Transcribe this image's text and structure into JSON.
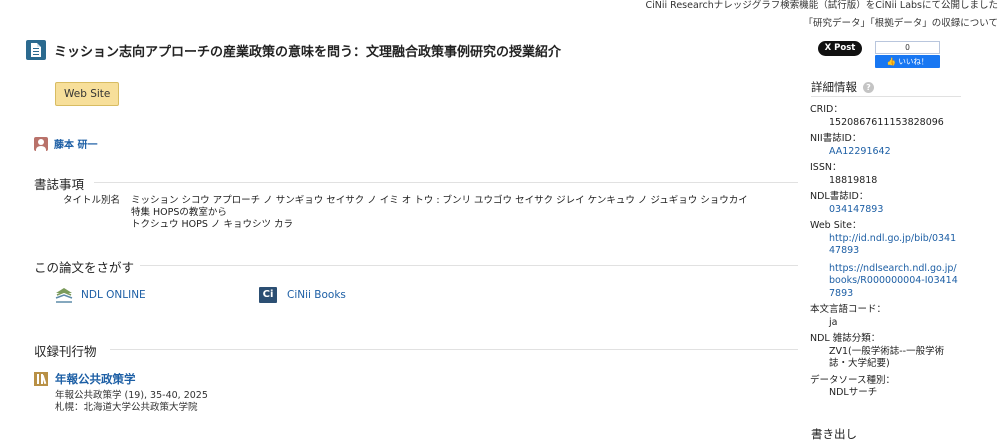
{
  "notice": {
    "line1": "CiNii Researchナレッジグラフ検索機能（試行版）をCiNii Labsにて公開しました",
    "line2": "「研究データ」「根拠データ」の収録について"
  },
  "article": {
    "title": "ミッション志向アプローチの産業政策の意味を問う：文理融合政策事例研究の授業紹介",
    "website_button": "Web Site",
    "author": "藤本 研一"
  },
  "bibliography": {
    "heading": "書誌事項",
    "label": "タイトル別名",
    "values": [
      "ミッション シコウ アプローチ ノ サンギョウ セイサク ノ イミ オ トウ : ブンリ ユウゴウ セイサク ジレイ ケンキュウ ノ ジュギョウ ショウカイ",
      "特集 HOPSの教室から",
      "トクシュウ HOPS ノ キョウシツ カラ"
    ]
  },
  "search": {
    "heading": "この論文をさがす",
    "links": [
      {
        "label": "NDL ONLINE",
        "icon": "ndl-icon"
      },
      {
        "label": "CiNii Books",
        "icon": "cinii-icon",
        "glyph": "Ci"
      }
    ]
  },
  "included": {
    "heading": "収録刊行物",
    "journal": "年報公共政策学",
    "meta1": "年報公共政策学 (19), 35-40, 2025",
    "meta2": "札幌：北海道大学公共政策大学院"
  },
  "social": {
    "x_post": "X Post",
    "fb_count": "0",
    "fb_like": "👍 いいね！"
  },
  "details": {
    "heading": "詳細情報",
    "help": "?",
    "items": [
      {
        "key": "CRID：",
        "value": "1520867611153828096",
        "link": false
      },
      {
        "key": "NII書誌ID：",
        "value": "AA12291642",
        "link": true
      },
      {
        "key": "ISSN：",
        "value": "18819818",
        "link": false
      },
      {
        "key": "NDL書誌ID：",
        "value": "034147893",
        "link": true
      },
      {
        "key": "Web Site：",
        "value": "http://id.ndl.go.jp/bib/034147893",
        "link": true
      },
      {
        "key": "",
        "value": "https://ndlsearch.ndl.go.jp/books/R000000004-I034147893",
        "link": true
      },
      {
        "key": "本文言語コード：",
        "value": "ja",
        "link": false
      },
      {
        "key": "NDL 雑誌分類：",
        "value": "ZV1(一般学術誌--一般学術誌・大学紀要)",
        "link": false
      },
      {
        "key": "データソース種別：",
        "value": "NDLサーチ",
        "link": false
      }
    ],
    "write_heading": "書き出し"
  }
}
